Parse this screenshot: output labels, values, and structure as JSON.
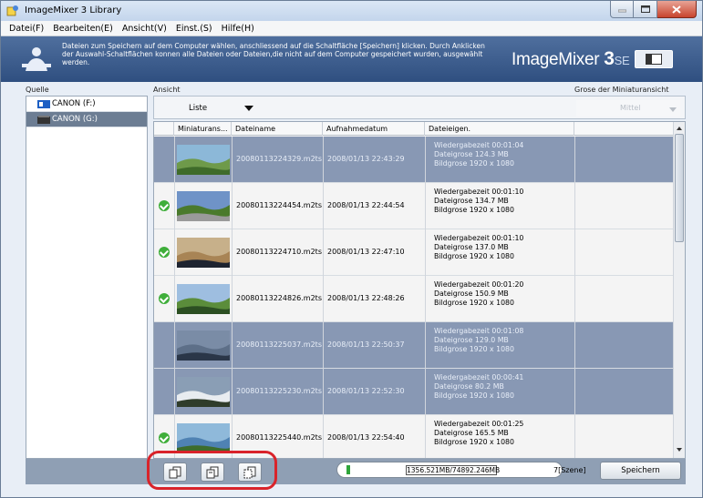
{
  "window": {
    "title": "ImageMixer 3 Library"
  },
  "menu": [
    "Datei(F)",
    "Bearbeiten(E)",
    "Ansicht(V)",
    "Einst.(S)",
    "Hilfe(H)"
  ],
  "banner": {
    "instructions": "Dateien zum Speichern auf dem Computer wählen, anschliessend auf die Schaltfläche [Speichern] klicken. Durch Anklicken der Auswahl-Schaltflächen konnen alle Dateien oder Dateien,die nicht auf dem Computer gespeichert wurden, ausgewählt werden.",
    "brand_main": "ImageMixer ",
    "brand_number": "3",
    "brand_edition": "SE"
  },
  "labels": {
    "source": "Quelle",
    "view": "Ansicht",
    "thumb_size": "Grose der Miniaturansicht"
  },
  "sources": [
    {
      "label": "CANON (F:)"
    },
    {
      "label": "CANON (G:)"
    }
  ],
  "view_combo": {
    "value": "Liste"
  },
  "thumb_combo": {
    "value": "Mittel"
  },
  "columns": [
    "Miniaturans...",
    "Dateiname",
    "Aufnahmedatum",
    "Dateieigen."
  ],
  "rows": [
    {
      "checked": false,
      "selected": true,
      "file": "20080113224329.m2ts",
      "date": "2008/01/13 22:43:29",
      "duration": "Wiedergabezeit 00:01:04",
      "size": "Dateigrose 124.3 MB",
      "resolution": "Bildgrose 1920 x 1080"
    },
    {
      "checked": true,
      "selected": false,
      "file": "20080113224454.m2ts",
      "date": "2008/01/13 22:44:54",
      "duration": "Wiedergabezeit 00:01:10",
      "size": "Dateigrose 134.7 MB",
      "resolution": "Bildgrose 1920 x 1080"
    },
    {
      "checked": true,
      "selected": false,
      "file": "20080113224710.m2ts",
      "date": "2008/01/13 22:47:10",
      "duration": "Wiedergabezeit 00:01:10",
      "size": "Dateigrose 137.0 MB",
      "resolution": "Bildgrose 1920 x 1080"
    },
    {
      "checked": true,
      "selected": false,
      "file": "20080113224826.m2ts",
      "date": "2008/01/13 22:48:26",
      "duration": "Wiedergabezeit 00:01:20",
      "size": "Dateigrose 150.9 MB",
      "resolution": "Bildgrose 1920 x 1080"
    },
    {
      "checked": false,
      "selected": true,
      "file": "20080113225037.m2ts",
      "date": "2008/01/13 22:50:37",
      "duration": "Wiedergabezeit 00:01:08",
      "size": "Dateigrose 129.0 MB",
      "resolution": "Bildgrose 1920 x 1080"
    },
    {
      "checked": false,
      "selected": true,
      "file": "20080113225230.m2ts",
      "date": "2008/01/13 22:52:30",
      "duration": "Wiedergabezeit 00:00:41",
      "size": "Dateigrose 80.2 MB",
      "resolution": "Bildgrose 1920 x 1080"
    },
    {
      "checked": true,
      "selected": false,
      "file": "20080113225440.m2ts",
      "date": "2008/01/13 22:54:40",
      "duration": "Wiedergabezeit 00:01:25",
      "size": "Dateigrose 165.5 MB",
      "resolution": "Bildgrose 1920 x 1080"
    }
  ],
  "capacity": {
    "text": "1356.521MB/74892.246MB",
    "used_fraction": 0.018
  },
  "scene_count": "7[Szene]",
  "save_label": "Speichern",
  "colors": {
    "selected_row": "#8898b4",
    "banner": "#3a5a8c",
    "check": "#3fae3a",
    "highlight": "#d9232a"
  }
}
